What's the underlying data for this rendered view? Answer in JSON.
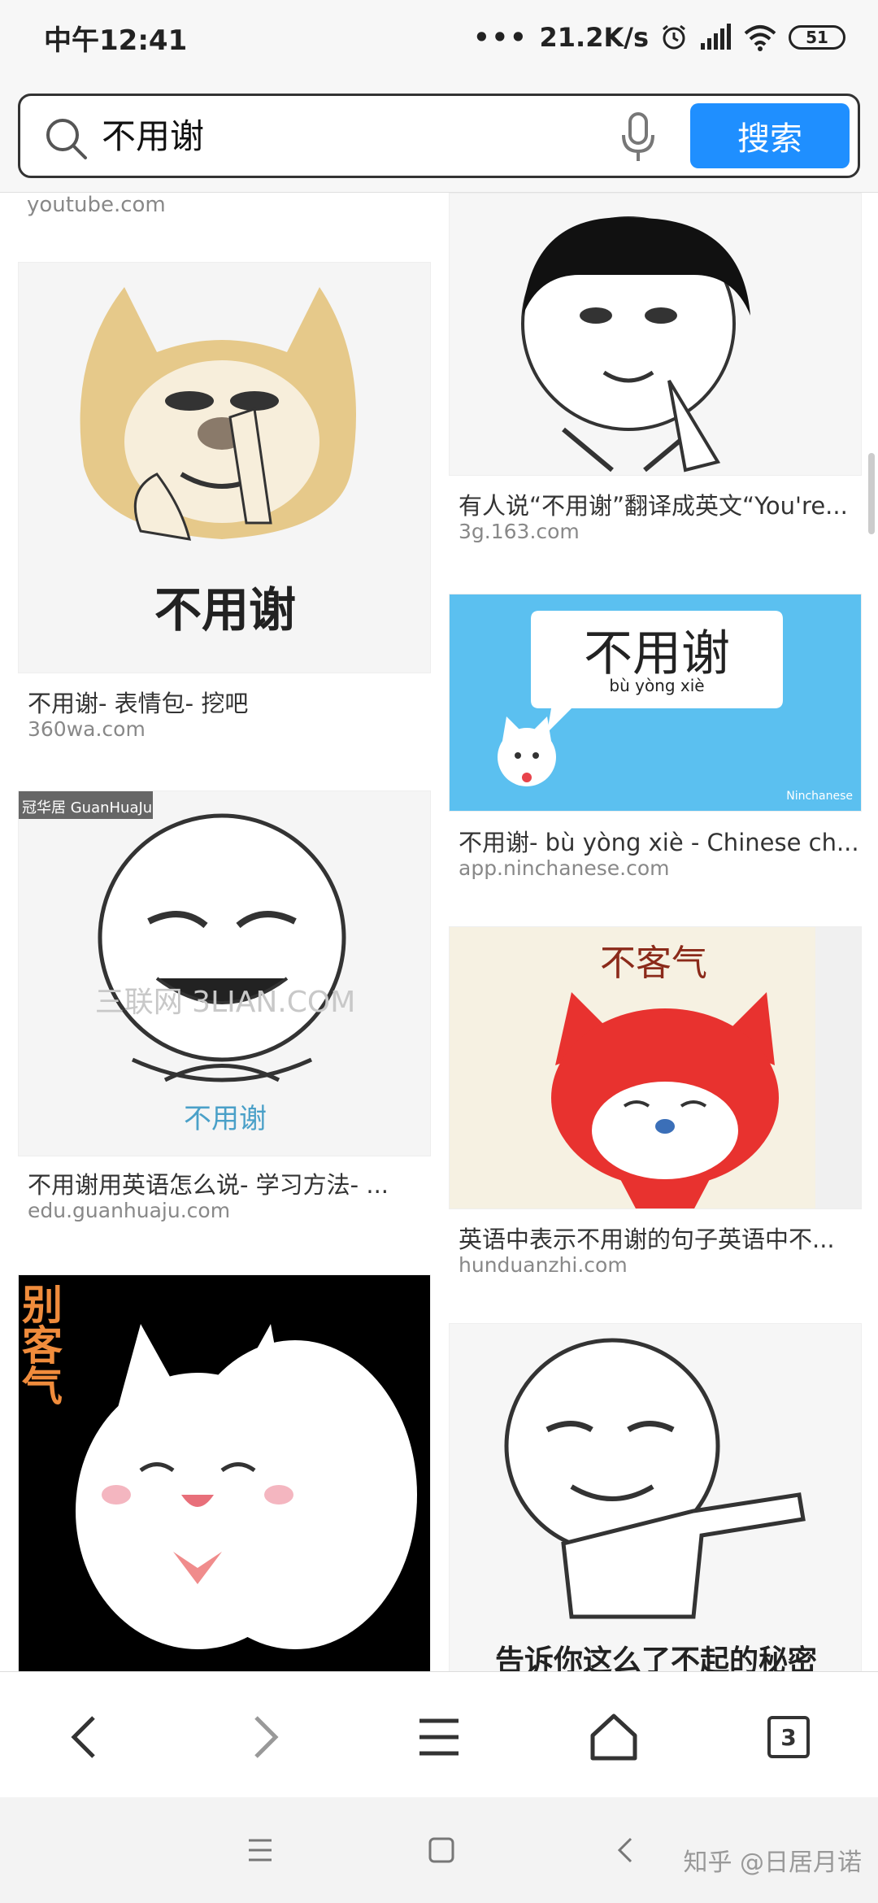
{
  "status_bar": {
    "time": "中午12:41",
    "network_speed": "21.2K/s",
    "battery": "51"
  },
  "search": {
    "query": "不用谢",
    "button_label": "搜索"
  },
  "top_domain": "youtube.com",
  "results": [
    {
      "title": "不用谢- 表情包- 挖吧",
      "domain": "360wa.com",
      "image_caption": "不用谢",
      "image_desc": "doge-face-meme"
    },
    {
      "title": "有人说“不用谢”翻译成英文“You're...",
      "domain": "3g.163.com",
      "image_caption": "",
      "image_desc": "mushroom-hair-meme"
    },
    {
      "title": "不用谢- bù yòng xiè - Chinese ch...",
      "domain": "app.ninchanese.com",
      "image_caption": "不用谢",
      "image_pinyin": "bù yòng xiè",
      "image_brand": "Ninchanese"
    },
    {
      "title": "不用谢用英语怎么说- 学习方法- ...",
      "domain": "edu.guanhuaju.com",
      "image_caption": "不用谢",
      "image_brand": "冠华居 GuanHuaJu",
      "image_watermark": "三联网 3LIAN.COM"
    },
    {
      "title": "英语中表示不用谢的句子英语中不...",
      "domain": "hunduanzhi.com",
      "image_caption": "不客气",
      "image_desc": "red-fox-cartoon"
    },
    {
      "title": "",
      "domain": "",
      "image_caption": "别客气",
      "image_desc": "white-cat-cartoon"
    },
    {
      "title": "",
      "domain": "",
      "image_caption": "告诉你这么了不起的秘密",
      "image_desc": "rage-face-pointing"
    }
  ],
  "browser_nav": {
    "tab_count": "3"
  },
  "watermark": "知乎 @日居月诺",
  "colors": {
    "accent": "#1f8fff",
    "ninchanese_bg": "#5bc0f0",
    "meme_black": "#000000"
  }
}
